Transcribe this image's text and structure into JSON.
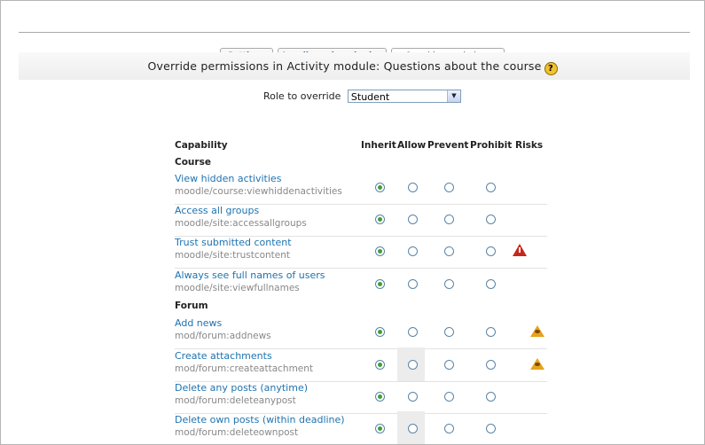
{
  "tabs": [
    {
      "label": "Settings",
      "active": false
    },
    {
      "label": "Locally assigned roles",
      "active": false
    },
    {
      "label": "Override permissions",
      "active": true
    }
  ],
  "heading": "Override permissions in Activity module: Questions about the course",
  "help_icon": "?",
  "role": {
    "label": "Role to override",
    "selected": "Student"
  },
  "columns": {
    "capability": "Capability",
    "inherit": "Inherit",
    "allow": "Allow",
    "prevent": "Prevent",
    "prohibit": "Prohibit",
    "risks": "Risks"
  },
  "sections": [
    {
      "title": "Course"
    },
    {
      "title": "Forum"
    }
  ],
  "rows": [
    {
      "name": "View hidden activities",
      "key": "moodle/course:viewhiddenactivities",
      "checked": "inherit",
      "risk": "",
      "allow_highlight": false
    },
    {
      "name": "Access all groups",
      "key": "moodle/site:accessallgroups",
      "checked": "inherit",
      "risk": "",
      "allow_highlight": false
    },
    {
      "name": "Trust submitted content",
      "key": "moodle/site:trustcontent",
      "checked": "inherit",
      "risk": "xss-risk-icon",
      "allow_highlight": false
    },
    {
      "name": "Always see full names of users",
      "key": "moodle/site:viewfullnames",
      "checked": "inherit",
      "risk": "",
      "allow_highlight": false
    },
    {
      "name": "Add news",
      "key": "mod/forum:addnews",
      "checked": "inherit",
      "risk": "spam-risk-icon",
      "allow_highlight": false
    },
    {
      "name": "Create attachments",
      "key": "mod/forum:createattachment",
      "checked": "inherit",
      "risk": "spam-risk-icon",
      "allow_highlight": true
    },
    {
      "name": "Delete any posts (anytime)",
      "key": "mod/forum:deleteanypost",
      "checked": "inherit",
      "risk": "",
      "allow_highlight": false
    },
    {
      "name": "Delete own posts (within deadline)",
      "key": "mod/forum:deleteownpost",
      "checked": "inherit",
      "risk": "",
      "allow_highlight": true
    }
  ]
}
